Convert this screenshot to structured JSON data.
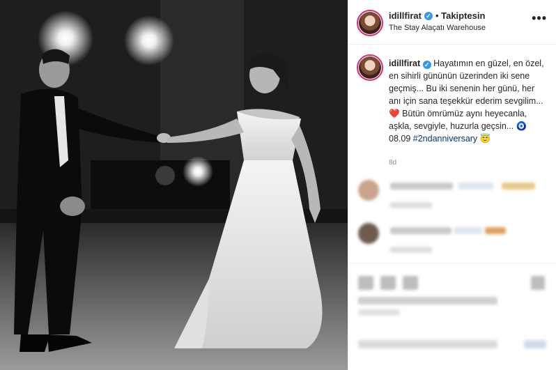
{
  "post": {
    "username": "idillfirat",
    "follow_status": "• Takiptesin",
    "location": "The Stay Alaçatı Warehouse",
    "more_icon": "more-dots-icon"
  },
  "caption": {
    "username": "idillfirat",
    "text": "Hayatımın en güzel, en özel, en sihirli gününün üzerinden iki sene geçmiş... Bu iki senenin her günü, her anı için sana teşekkür ederim sevgilim...",
    "heart": "❤️",
    "text2": "Bütün ömrümüz aynı heyecanla, aşkla, sevgiyle, huzurla geçsin...",
    "eye": "🧿",
    "date": "08.09",
    "hashtag": "#2ndanniversary",
    "emoji_end": "😇"
  },
  "time_ago": "8d",
  "colors": {
    "verified": "#3897f0",
    "ring": "#d62976",
    "hashtag": "#00376b",
    "muted": "#8e8e8e"
  }
}
